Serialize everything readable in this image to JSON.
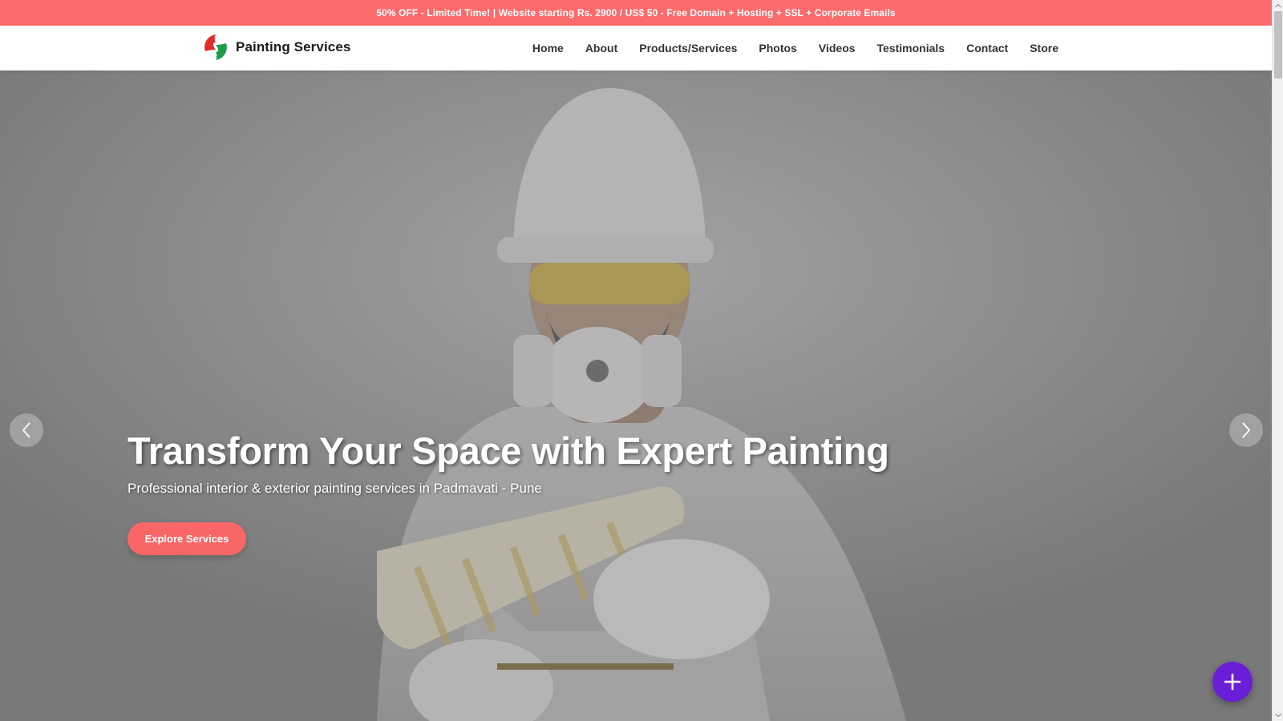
{
  "promo": {
    "text": "50% OFF - Limited Time! | Website starting Rs. 2900 / US$ 50 - Free Domain + Hosting + SSL + Corporate Emails"
  },
  "header": {
    "brand_name": "Painting Services",
    "logo_icon": "leaf-swirl-logo",
    "logo_colors": [
      "#e02b2b",
      "#1e9c4a"
    ]
  },
  "nav": {
    "items": [
      "Home",
      "About",
      "Products/Services",
      "Photos",
      "Videos",
      "Testimonials",
      "Contact",
      "Store"
    ]
  },
  "hero": {
    "title": "Transform Your Space with Expert Painting",
    "subtitle": "Professional interior & exterior painting services in Padmavati - Pune",
    "cta_label": "Explore Services",
    "prev_icon": "chevron-left-icon",
    "next_icon": "chevron-right-icon"
  },
  "fab": {
    "icon": "plus-icon",
    "color": "#6a1fd6"
  },
  "colors": {
    "accent": "#fb6b6b",
    "text_dark": "#333333"
  }
}
